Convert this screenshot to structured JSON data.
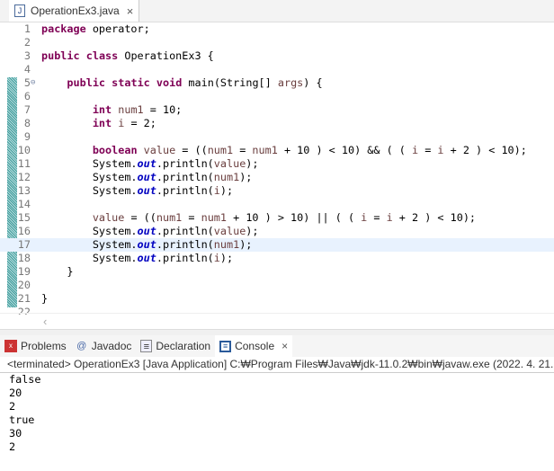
{
  "editor_tab": {
    "title": "OperationEx3.java",
    "icon": "java-file-icon",
    "close": "×"
  },
  "code_lines": [
    {
      "n": "1",
      "t": [
        [
          "package",
          "kw"
        ],
        [
          " operator;",
          ""
        ]
      ]
    },
    {
      "n": "2",
      "t": []
    },
    {
      "n": "3",
      "t": [
        [
          "public",
          "kw"
        ],
        [
          " ",
          ""
        ],
        [
          "class",
          "kw"
        ],
        [
          " OperationEx3 {",
          ""
        ]
      ]
    },
    {
      "n": "4",
      "t": []
    },
    {
      "n": "5",
      "t": [
        [
          "    ",
          ""
        ],
        [
          "public",
          "kw"
        ],
        [
          " ",
          ""
        ],
        [
          "static",
          "kw"
        ],
        [
          " ",
          ""
        ],
        [
          "void",
          "kw"
        ],
        [
          " main(String[] ",
          ""
        ],
        [
          "args",
          "var"
        ],
        [
          ") {",
          ""
        ]
      ]
    },
    {
      "n": "6",
      "t": []
    },
    {
      "n": "7",
      "t": [
        [
          "        ",
          ""
        ],
        [
          "int",
          "kw"
        ],
        [
          " ",
          ""
        ],
        [
          "num1",
          "var"
        ],
        [
          " = 10;",
          ""
        ]
      ]
    },
    {
      "n": "8",
      "t": [
        [
          "        ",
          ""
        ],
        [
          "int",
          "kw"
        ],
        [
          " ",
          ""
        ],
        [
          "i",
          "var"
        ],
        [
          " = 2;",
          ""
        ]
      ]
    },
    {
      "n": "9",
      "t": []
    },
    {
      "n": "10",
      "t": [
        [
          "        ",
          ""
        ],
        [
          "boolean",
          "kw"
        ],
        [
          " ",
          ""
        ],
        [
          "value",
          "var"
        ],
        [
          " = ((",
          ""
        ],
        [
          "num1",
          "var"
        ],
        [
          " = ",
          ""
        ],
        [
          "num1",
          "var"
        ],
        [
          " + 10 ) < 10) && ( ( ",
          ""
        ],
        [
          "i",
          "var"
        ],
        [
          " = ",
          ""
        ],
        [
          "i",
          "var"
        ],
        [
          " + 2 ) < 10);",
          ""
        ]
      ]
    },
    {
      "n": "11",
      "t": [
        [
          "        System.",
          ""
        ],
        [
          "out",
          "fld"
        ],
        [
          ".println(",
          ""
        ],
        [
          "value",
          "var"
        ],
        [
          ");",
          ""
        ]
      ]
    },
    {
      "n": "12",
      "t": [
        [
          "        System.",
          ""
        ],
        [
          "out",
          "fld"
        ],
        [
          ".println(",
          ""
        ],
        [
          "num1",
          "var"
        ],
        [
          ");",
          ""
        ]
      ]
    },
    {
      "n": "13",
      "t": [
        [
          "        System.",
          ""
        ],
        [
          "out",
          "fld"
        ],
        [
          ".println(",
          ""
        ],
        [
          "i",
          "var"
        ],
        [
          ");",
          ""
        ]
      ]
    },
    {
      "n": "14",
      "t": []
    },
    {
      "n": "15",
      "t": [
        [
          "        ",
          ""
        ],
        [
          "value",
          "var"
        ],
        [
          " = ((",
          ""
        ],
        [
          "num1",
          "var"
        ],
        [
          " = ",
          ""
        ],
        [
          "num1",
          "var"
        ],
        [
          " + 10 ) > 10) || ( ( ",
          ""
        ],
        [
          "i",
          "var"
        ],
        [
          " = ",
          ""
        ],
        [
          "i",
          "var"
        ],
        [
          " + 2 ) < 10);",
          ""
        ]
      ]
    },
    {
      "n": "16",
      "t": [
        [
          "        System.",
          ""
        ],
        [
          "out",
          "fld"
        ],
        [
          ".println(",
          ""
        ],
        [
          "value",
          "var"
        ],
        [
          ");",
          ""
        ]
      ]
    },
    {
      "n": "17",
      "t": [
        [
          "        System.",
          ""
        ],
        [
          "out",
          "fld"
        ],
        [
          ".println(",
          ""
        ],
        [
          "num1",
          "var"
        ],
        [
          ");",
          ""
        ]
      ]
    },
    {
      "n": "18",
      "t": [
        [
          "        System.",
          ""
        ],
        [
          "out",
          "fld"
        ],
        [
          ".println(",
          ""
        ],
        [
          "i",
          "var"
        ],
        [
          ");",
          ""
        ]
      ]
    },
    {
      "n": "19",
      "t": [
        [
          "    }",
          ""
        ]
      ]
    },
    {
      "n": "20",
      "t": []
    },
    {
      "n": "21",
      "t": [
        [
          "}",
          ""
        ]
      ]
    },
    {
      "n": "22",
      "t": []
    }
  ],
  "views": {
    "tabs": [
      {
        "label": "Problems",
        "icon": "problems-icon"
      },
      {
        "label": "Javadoc",
        "icon": "javadoc-icon"
      },
      {
        "label": "Declaration",
        "icon": "declaration-icon"
      },
      {
        "label": "Console",
        "icon": "console-icon",
        "active": true
      }
    ],
    "console_close": "×",
    "status": "<terminated> OperationEx3 [Java Application] C:₩Program Files₩Java₩jdk-11.0.2₩bin₩javaw.exe  (2022. 4. 21.",
    "output": [
      "false",
      "20",
      "2",
      "true",
      "30",
      "2"
    ]
  }
}
